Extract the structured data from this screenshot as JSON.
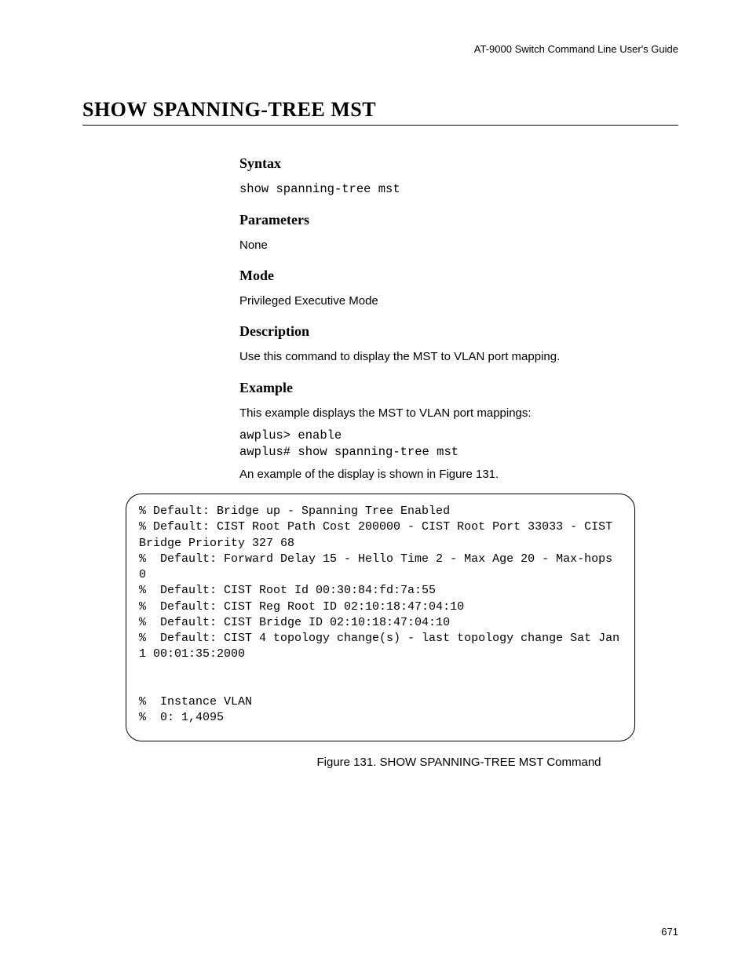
{
  "header": {
    "running": "AT-9000 Switch Command Line User's Guide"
  },
  "title": "SHOW SPANNING-TREE MST",
  "sections": {
    "syntax": {
      "heading": "Syntax",
      "code": "show spanning-tree mst"
    },
    "parameters": {
      "heading": "Parameters",
      "text": "None"
    },
    "mode": {
      "heading": "Mode",
      "text": "Privileged Executive Mode"
    },
    "description": {
      "heading": "Description",
      "text": "Use this command to display the MST to VLAN port mapping."
    },
    "example": {
      "heading": "Example",
      "intro": "This example displays the MST to VLAN port mappings:",
      "code": "awplus> enable\nawplus# show spanning-tree mst",
      "note": "An example of the display is shown in Figure 131."
    }
  },
  "output": "% Default: Bridge up - Spanning Tree Enabled\n% Default: CIST Root Path Cost 200000 - CIST Root Port 33033 - CIST Bridge Priority 327 68\n%  Default: Forward Delay 15 - Hello Time 2 - Max Age 20 - Max-hops 0\n%  Default: CIST Root Id 00:30:84:fd:7a:55\n%  Default: CIST Reg Root ID 02:10:18:47:04:10\n%  Default: CIST Bridge ID 02:10:18:47:04:10\n%  Default: CIST 4 topology change(s) - last topology change Sat Jan 1 00:01:35:2000\n\n\n%  Instance VLAN\n%  0: 1,4095",
  "figure_caption": "Figure 131. SHOW SPANNING-TREE MST Command",
  "page_number": "671"
}
